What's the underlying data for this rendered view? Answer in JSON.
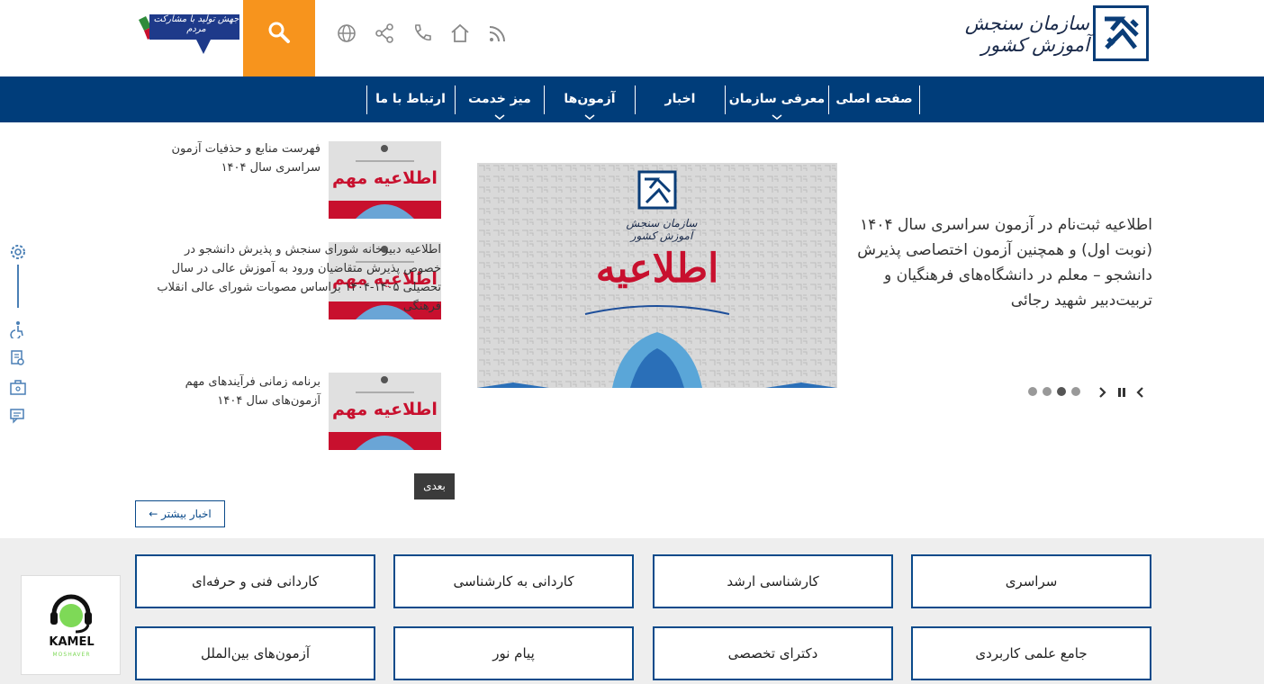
{
  "header": {
    "logo_text": "سازمان سنجش آموزش کشور",
    "campaign_text": "جهش تولید با مشارکت مردم",
    "icons": [
      "rss-icon",
      "home-icon",
      "phone-icon",
      "share-icon",
      "globe-icon",
      "search-icon"
    ]
  },
  "colors": {
    "primary": "#003d7a",
    "accent": "#f7941d",
    "banner_red": "#c8102e"
  },
  "nav": {
    "items": [
      {
        "label": "صفحه اصلی",
        "has_dropdown": false
      },
      {
        "label": "معرفی سازمان",
        "has_dropdown": true
      },
      {
        "label": "اخبار",
        "has_dropdown": false
      },
      {
        "label": "آزمون‌ها",
        "has_dropdown": true
      },
      {
        "label": "میز خدمت",
        "has_dropdown": true
      },
      {
        "label": "ارتباط با ما",
        "has_dropdown": false
      }
    ]
  },
  "slider": {
    "image_title": "اطلاعیه",
    "image_org": "سازمان سنجش آموزش کشور",
    "headline": "اطلاعیه ثبت‌نام در آزمون سراسری  سال ۱۴۰۴ (نوبت اول) و همچنین آزمون اختصاصی پذیرش دانشجو – معلم در دانشگاه‌های فرهنگیان و تربیت‌دبیر شهید رجائی",
    "dots": 4,
    "active_dot": 2
  },
  "news": {
    "thumb_label": "اطلاعیه مهم",
    "items": [
      {
        "title": "فهرست منابع و حذفیات آزمون سراسری سال ۱۴۰۴"
      },
      {
        "title": "اطلاعیه دبیرخانه شورای سنجش و پذیرش دانشجو در خصوص پذیرش متقاضیان ورود به آموزش عالی در سال تحصیلی ۱۴۰۵-۱۴۰۴ براساس مصوبات شورای عالی انقلاب فرهنگی"
      },
      {
        "title": "برنامه زمانی فرآیندهای مهم آزمون‌های سال ۱۴۰۴"
      }
    ],
    "next_label": "بعدی",
    "more_label": "اخبار بیشتر ←"
  },
  "categories": {
    "row1": [
      "سراسری",
      "کارشناسی ارشد",
      "کاردانی به کارشناسی",
      "کاردانی فنی و حرفه‌ای"
    ],
    "row2": [
      "جامع علمی کاربردی",
      "دکترای تخصصی",
      "پیام نور",
      "آزمون‌های بین‌الملل"
    ]
  },
  "kamel": {
    "name": "KAMEL",
    "sub": "MOSHAVER"
  }
}
